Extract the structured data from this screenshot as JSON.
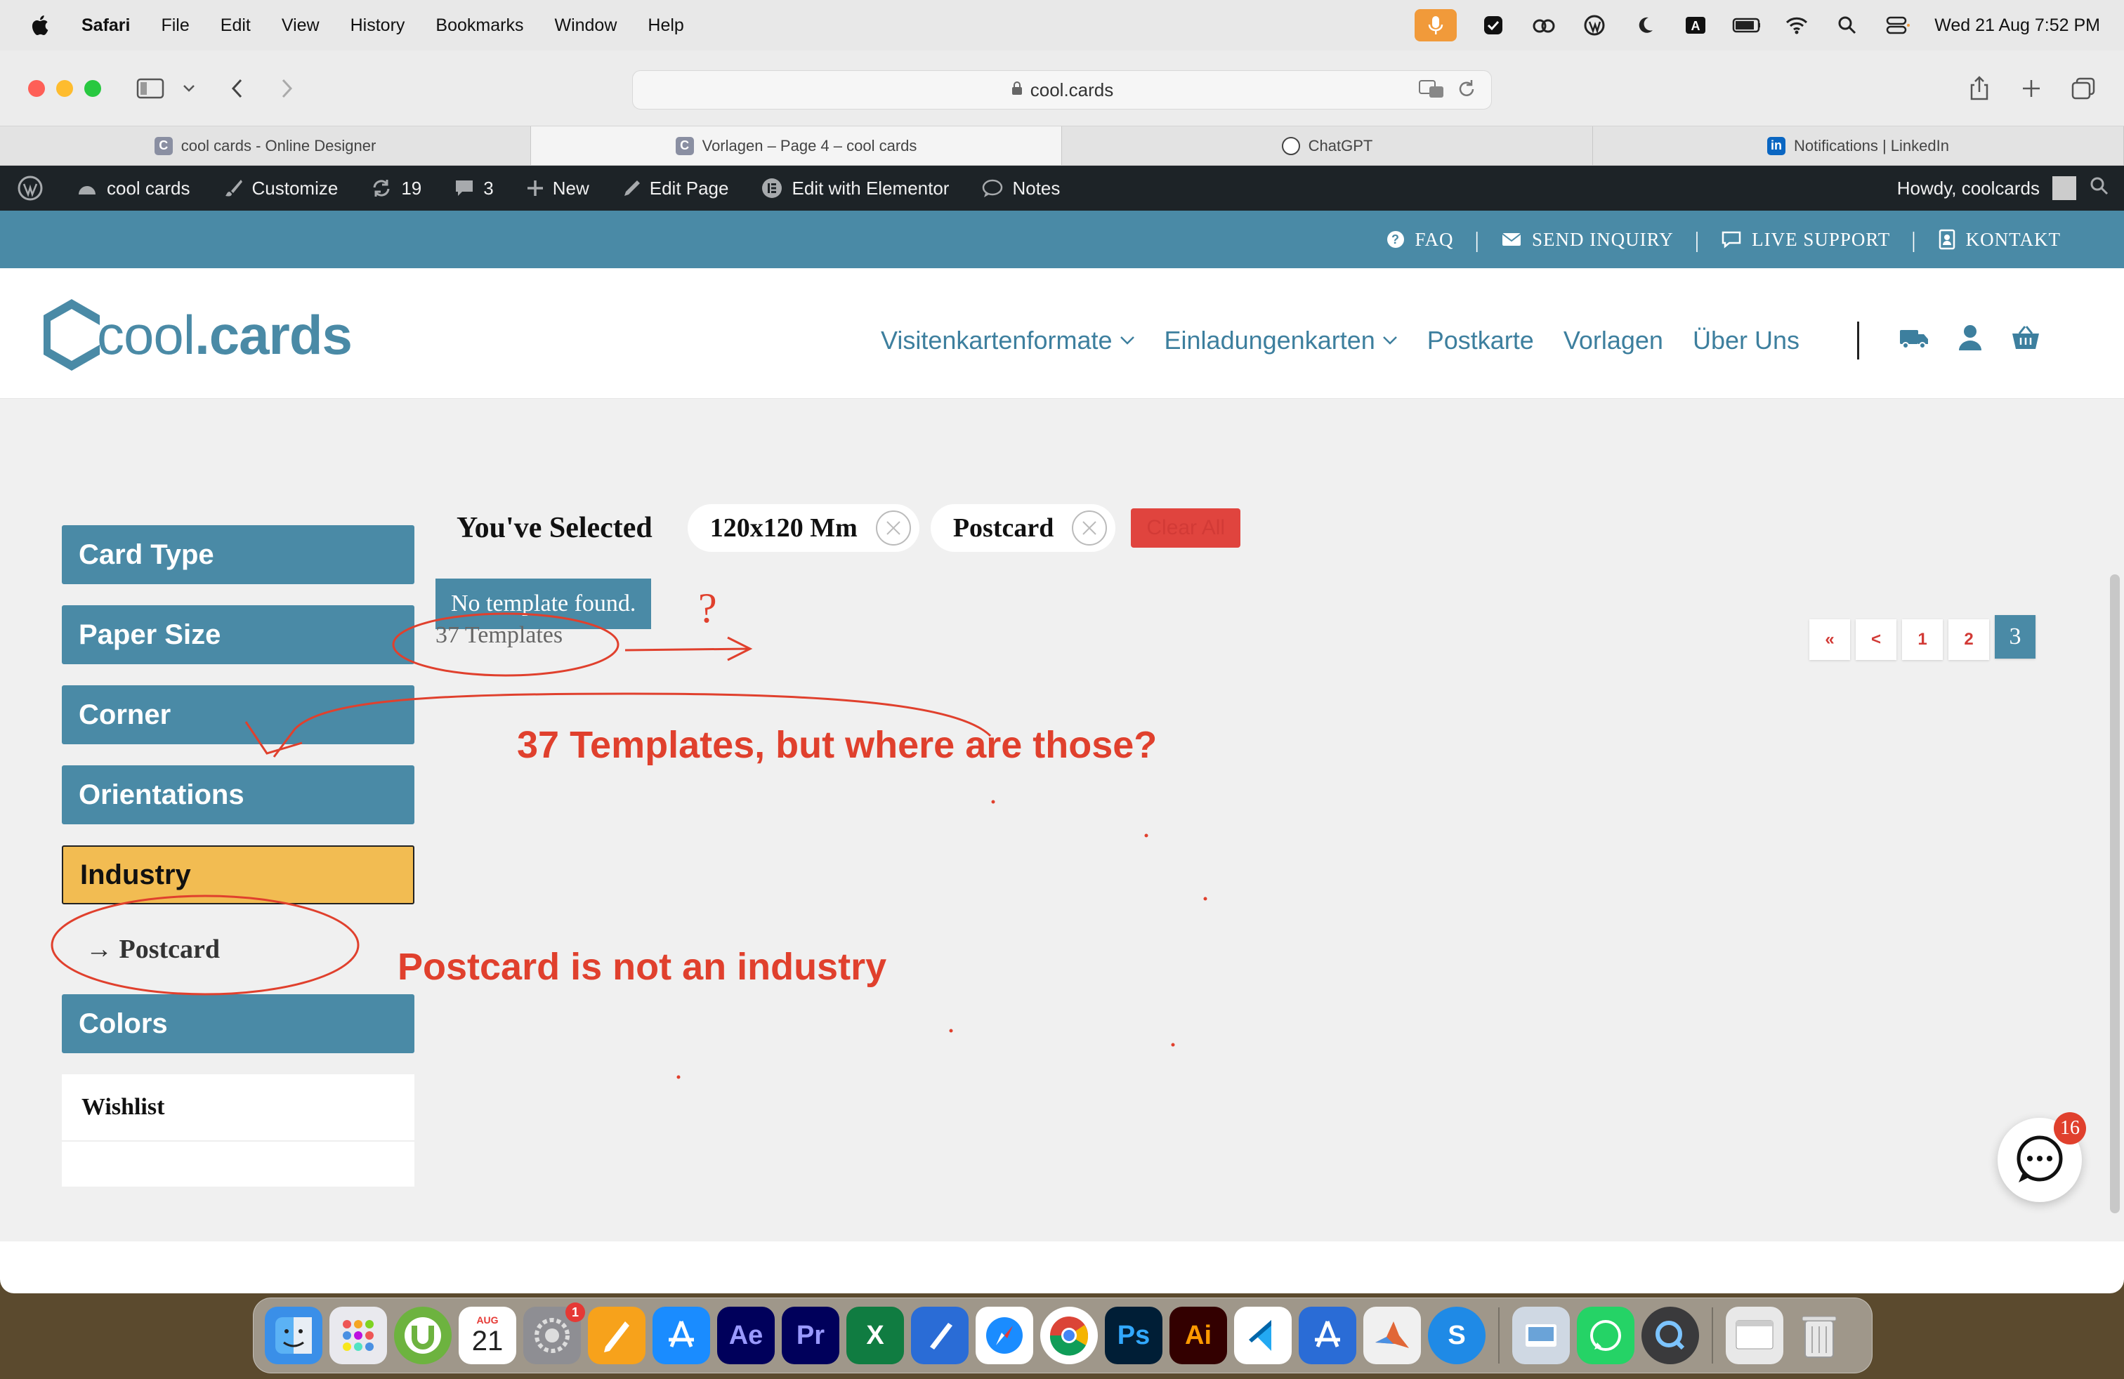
{
  "menubar": {
    "app_name": "Safari",
    "items": [
      "File",
      "Edit",
      "View",
      "History",
      "Bookmarks",
      "Window",
      "Help"
    ],
    "clock": "Wed 21 Aug  7:52 PM"
  },
  "browser": {
    "url": "cool.cards",
    "tabs": [
      {
        "label": "cool cards - Online Designer",
        "favicon": "C"
      },
      {
        "label": "Vorlagen – Page 4 – cool cards",
        "favicon": "C"
      },
      {
        "label": "ChatGPT",
        "favicon": "gpt"
      },
      {
        "label": "Notifications | LinkedIn",
        "favicon": "in"
      }
    ]
  },
  "adminbar": {
    "site": "cool cards",
    "customize": "Customize",
    "updates": "19",
    "comments": "3",
    "new": "New",
    "edit_page": "Edit Page",
    "elementor": "Edit with Elementor",
    "notes": "Notes",
    "howdy": "Howdy, coolcards"
  },
  "topbar": {
    "faq": "FAQ",
    "inquiry": "SEND INQUIRY",
    "support": "LIVE SUPPORT",
    "kontakt": "KONTAKT"
  },
  "header": {
    "logo_word1": "cool",
    "logo_word2": ".cards",
    "nav": [
      "Visitenkartenformate",
      "Einladungenkarten",
      "Postkarte",
      "Vorlagen",
      "Über Uns"
    ]
  },
  "filters": {
    "card_type": "Card Type",
    "paper_size": "Paper Size",
    "corner": "Corner",
    "orientations": "Orientations",
    "industry": "Industry",
    "industry_sub": "→ Postcard",
    "colors": "Colors",
    "wishlist": "Wishlist"
  },
  "selection": {
    "label": "You've Selected",
    "chips": [
      "120x120 Mm",
      "Postcard"
    ],
    "clear_all": "Clear All"
  },
  "results": {
    "notice": "No template found.",
    "count": "37 Templates"
  },
  "pagination": {
    "first": "«",
    "prev": "<",
    "pages": [
      "1",
      "2",
      "3"
    ],
    "current": "3"
  },
  "annotations": {
    "question": "37 Templates, but where are those?",
    "industry_note": "Postcard is not an industry",
    "qmark": "?"
  },
  "chat": {
    "badge": "16"
  },
  "dock": {
    "calendar_month": "AUG",
    "calendar_day": "21",
    "settings_badge": "1"
  },
  "colors": {
    "brand": "#4a8aa6",
    "accent_yellow": "#f2bc52",
    "annotation_red": "#e0402d"
  }
}
